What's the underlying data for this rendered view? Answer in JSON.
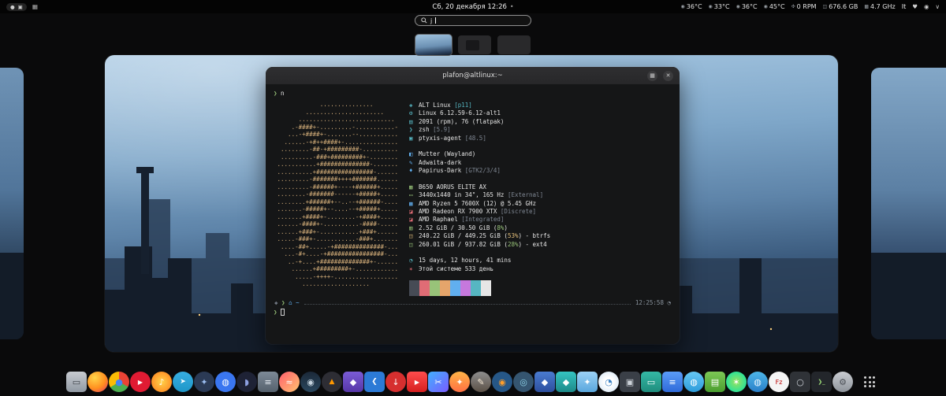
{
  "top_bar": {
    "clock": "Сб, 20 декабря 12:26",
    "notification_dot": "•",
    "keyboard_layout": "It",
    "indicators": {
      "record_glyph": "●",
      "screen_glyph": "▣",
      "tray_glyph": "▦"
    },
    "menu_icons": {
      "heart": "♥",
      "status": "◉",
      "chevron": "∨"
    },
    "stats": [
      {
        "name": "cpu-temp",
        "glyph": "◉",
        "value": "36°C"
      },
      {
        "name": "board-temp",
        "glyph": "◉",
        "value": "33°C"
      },
      {
        "name": "gpu-temp",
        "glyph": "◉",
        "value": "36°C"
      },
      {
        "name": "drive-temp",
        "glyph": "◉",
        "value": "45°C"
      },
      {
        "name": "fan-speed",
        "glyph": "✣",
        "value": "0 RPM"
      },
      {
        "name": "disk-free",
        "glyph": "◫",
        "value": "676.6 GB"
      },
      {
        "name": "cpu-freq",
        "glyph": "▩",
        "value": "4.7 GHz"
      }
    ]
  },
  "search": {
    "query": "j"
  },
  "workspaces": [
    {
      "name": "workspace-1",
      "active": true,
      "has_window": false
    },
    {
      "name": "workspace-2",
      "active": false,
      "has_window": true
    },
    {
      "name": "workspace-3",
      "active": false,
      "has_window": false
    }
  ],
  "terminal": {
    "title": "plafon@altlinux:~",
    "header_buttons": {
      "menu": "▦",
      "close": "✕"
    },
    "prompt_symbol": "❯",
    "command": "n",
    "ascii_color": "#d9b27c",
    "ascii_art": [
      "             ...............",
      "         ......................",
      "       ...........................",
      "     .-####+-.........-...........-",
      "    ...-+####+-.......--...........",
      "   ......-+#++####+-...............",
      "  ........-##-+#########-..........",
      "  .........-###+#########+-........",
      " ...........+##############-.......",
      " ..........+################-......",
      " .........-#######++++#######......",
      " .........-######+----+######+.....",
      " ........-#######------+#####+.....",
      " ........+######+--..--+######-....",
      " .......-#####+--....--+#####+.....",
      " .......+####+-........-+####+.....",
      " ......-####+-..........-####-.....",
      " ......+###+-...........+###+......",
      " .....-###+-...........-###+.......",
      "  ....-##+.....-+##############-...",
      "   ...-#+....-+################-...",
      "    ..-+....+##############+-......",
      "     ......+#########+-............",
      "      .....-++++-..................",
      "        ..................."
    ],
    "info": [
      {
        "icon": "◈",
        "ic": "#56b6c2",
        "parts": [
          {
            "t": "ALT Linux "
          },
          {
            "t": "[p11]",
            "c": "#56b6c2"
          }
        ]
      },
      {
        "icon": "⚙",
        "ic": "#56b6c2",
        "parts": [
          {
            "t": "Linux 6.12.59-6.12-alt1"
          }
        ]
      },
      {
        "icon": "▤",
        "ic": "#56b6c2",
        "parts": [
          {
            "t": "2091 (rpm), 76 (flatpak)"
          }
        ]
      },
      {
        "icon": "❯",
        "ic": "#56b6c2",
        "parts": [
          {
            "t": "zsh "
          },
          {
            "t": "[5.9]",
            "c": "#7f8793"
          }
        ]
      },
      {
        "icon": "▣",
        "ic": "#56b6c2",
        "parts": [
          {
            "t": "ptyxis-agent "
          },
          {
            "t": "[48.5]",
            "c": "#7f8793"
          }
        ]
      },
      {
        "blank": true
      },
      {
        "icon": "◧",
        "ic": "#61afef",
        "parts": [
          {
            "t": "Mutter (Wayland)"
          }
        ]
      },
      {
        "icon": "✎",
        "ic": "#61afef",
        "parts": [
          {
            "t": "Adwaita-dark"
          }
        ]
      },
      {
        "icon": "♦",
        "ic": "#61afef",
        "parts": [
          {
            "t": "Papirus-Dark "
          },
          {
            "t": "[GTK2/3/4]",
            "c": "#7f8793"
          }
        ]
      },
      {
        "blank": true
      },
      {
        "icon": "▦",
        "ic": "#98c379",
        "parts": [
          {
            "t": "B650 AORUS ELITE AX"
          }
        ]
      },
      {
        "icon": "▭",
        "ic": "#98c379",
        "parts": [
          {
            "t": "3440x1440 in 34\", 165 Hz "
          },
          {
            "t": "[External]",
            "c": "#7f8793"
          }
        ]
      },
      {
        "icon": "▩",
        "ic": "#61afef",
        "parts": [
          {
            "t": "AMD Ryzen 5 7600X (12) @ 5.45 GHz"
          }
        ]
      },
      {
        "icon": "◪",
        "ic": "#e06c75",
        "parts": [
          {
            "t": "AMD Radeon RX 7900 XTX "
          },
          {
            "t": "[Discrete]",
            "c": "#7f8793"
          }
        ]
      },
      {
        "icon": "◪",
        "ic": "#e06c75",
        "parts": [
          {
            "t": "AMD Raphael "
          },
          {
            "t": "[Integrated]",
            "c": "#7f8793"
          }
        ]
      },
      {
        "icon": "▥",
        "ic": "#98c379",
        "parts": [
          {
            "t": "2.52 GiB / 30.50 GiB ("
          },
          {
            "t": "8%",
            "c": "#98c379"
          },
          {
            "t": ")"
          }
        ]
      },
      {
        "icon": "◫",
        "ic": "#e5c07b",
        "parts": [
          {
            "t": "240.22 GiB / 449.25 GiB ("
          },
          {
            "t": "53%",
            "c": "#e5c07b"
          },
          {
            "t": ") - btrfs"
          }
        ]
      },
      {
        "icon": "◫",
        "ic": "#98c379",
        "parts": [
          {
            "t": "260.01 GiB / 937.82 GiB ("
          },
          {
            "t": "28%",
            "c": "#98c379"
          },
          {
            "t": ") - ext4"
          }
        ]
      },
      {
        "blank": true
      },
      {
        "icon": "◔",
        "ic": "#56b6c2",
        "parts": [
          {
            "t": "15 days, 12 hours, 41 mins"
          }
        ]
      },
      {
        "icon": "✶",
        "ic": "#e06c75",
        "parts": [
          {
            "t": "Этой системе 533 день"
          }
        ]
      }
    ],
    "palette": [
      "#464b55",
      "#e06c75",
      "#98c379",
      "#e5a56b",
      "#61afef",
      "#c678dd",
      "#56b6c2",
      "#e6e6e6"
    ],
    "status": {
      "lmark": "◆",
      "arrow": "❯",
      "path": "⌂ ~",
      "time": "12:25:58",
      "clock_glyph": "◔"
    },
    "cursor_prompt": "❯"
  },
  "dock": [
    {
      "n": "screenshot-tool",
      "bg": "linear-gradient(180deg,#c7cbd1,#9199a3)",
      "rd": "5px",
      "g": "▭",
      "gc": "#3c4147"
    },
    {
      "n": "firefox",
      "bg": "radial-gradient(circle at 35% 30%,#ffd54a,#ff8f1f 55%,#e3336d)",
      "rd": "50%",
      "g": "",
      "gc": "#fff"
    },
    {
      "n": "chromium",
      "bg": "conic-gradient(#ea4335 0 33%,#4caf50 33% 66%,#fbbc05 66% 100%)",
      "rd": "50%",
      "g": "●",
      "gc": "#4285f4"
    },
    {
      "n": "youtube-music",
      "bg": "#e01b33",
      "rd": "50%",
      "g": "▶",
      "gc": "#fff",
      "gs": "8px"
    },
    {
      "n": "music-app",
      "bg": "radial-gradient(circle,#ffd24a,#ff7a1a)",
      "rd": "50%",
      "g": "♪",
      "gc": "#fff"
    },
    {
      "n": "telegram",
      "bg": "linear-gradient(180deg,#37aee2,#1e96c8)",
      "rd": "50%",
      "g": "➤",
      "gc": "#fff",
      "gs": "9px"
    },
    {
      "n": "chat-app",
      "bg": "#2b3a55",
      "rd": "50%",
      "g": "✦",
      "gc": "#9bbdf0"
    },
    {
      "n": "messenger-app",
      "bg": "#3a76f0",
      "rd": "50%",
      "g": "◍",
      "gc": "#fff"
    },
    {
      "n": "discord",
      "bg": "#1e2235",
      "rd": "50%",
      "g": "◗",
      "gc": "#8ea1e1"
    },
    {
      "n": "text-editor",
      "bg": "linear-gradient(180deg,#7d8a97,#55616d)",
      "rd": "5px",
      "g": "≡",
      "gc": "#e8eef4"
    },
    {
      "n": "audio-editor",
      "bg": "linear-gradient(135deg,#ff5f6d,#ffc371)",
      "rd": "50%",
      "g": "≈",
      "gc": "#fff"
    },
    {
      "n": "steam",
      "bg": "linear-gradient(180deg,#1b2838,#2a475e)",
      "rd": "50%",
      "g": "◉",
      "gc": "#c7d5e0"
    },
    {
      "n": "game-launcher",
      "bg": "#2d2d34",
      "rd": "50%",
      "g": "▲",
      "gc": "#ff9800",
      "gs": "9px"
    },
    {
      "n": "heroic-launcher",
      "bg": "linear-gradient(180deg,#7b5cd6,#5636a7)",
      "rd": "5px",
      "g": "◆",
      "gc": "#fff"
    },
    {
      "n": "vscode",
      "bg": "#2c7ad6",
      "rd": "5px",
      "g": "❮",
      "gc": "#fff",
      "gs": "9px"
    },
    {
      "n": "download-manager",
      "bg": "#d62f2f",
      "rd": "50%",
      "g": "↓",
      "gc": "#fff"
    },
    {
      "n": "video-player",
      "bg": "linear-gradient(180deg,#ff4d4d,#d61f1f)",
      "rd": "5px",
      "g": "▶",
      "gc": "#fff",
      "gs": "8px"
    },
    {
      "n": "video-editor",
      "bg": "linear-gradient(135deg,#41b0ff,#7a5cff)",
      "rd": "5px",
      "g": "✂",
      "gc": "#fff"
    },
    {
      "n": "photo-tool",
      "bg": "linear-gradient(180deg,#ffb347,#ff7043)",
      "rd": "50%",
      "g": "✦",
      "gc": "#fff"
    },
    {
      "n": "gimp",
      "bg": "linear-gradient(180deg,#8d8d8d,#5c5147)",
      "rd": "50%",
      "g": "✎",
      "gc": "#f4e7d3"
    },
    {
      "n": "blender",
      "bg": "#265787",
      "rd": "50%",
      "g": "◉",
      "gc": "#ff9e2a"
    },
    {
      "n": "godot",
      "bg": "#355570",
      "rd": "50%",
      "g": "◎",
      "gc": "#8fd3e8"
    },
    {
      "n": "shield-app",
      "bg": "linear-gradient(180deg,#4a7bd0,#2d4f9e)",
      "rd": "5px",
      "g": "◆",
      "gc": "#fff"
    },
    {
      "n": "vpn-app",
      "bg": "linear-gradient(180deg,#35c3c1,#1d8a89)",
      "rd": "5px",
      "g": "◆",
      "gc": "#fff"
    },
    {
      "n": "utility-app",
      "bg": "linear-gradient(180deg,#9bd1f5,#5aa7dd)",
      "rd": "5px",
      "g": "✦",
      "gc": "#fff"
    },
    {
      "n": "disk-utility",
      "bg": "radial-gradient(circle,#ffffff 30%,#cfe3f5)",
      "rd": "50%",
      "g": "◔",
      "gc": "#3b82c4"
    },
    {
      "n": "package-manager",
      "bg": "#3a3f47",
      "rd": "5px",
      "g": "▣",
      "gc": "#cdd3da"
    },
    {
      "n": "display-tool",
      "bg": "linear-gradient(180deg,#34b8a5,#1f8d7d)",
      "rd": "5px",
      "g": "▭",
      "gc": "#fff"
    },
    {
      "n": "layers-app",
      "bg": "linear-gradient(180deg,#5a9cf8,#2f6ad9)",
      "rd": "5px",
      "g": "≡",
      "gc": "#fff"
    },
    {
      "n": "cloud-app",
      "bg": "linear-gradient(180deg,#66c7f4,#2d9cdb)",
      "rd": "50%",
      "g": "◍",
      "gc": "#fff"
    },
    {
      "n": "office-app",
      "bg": "linear-gradient(180deg,#7dc855,#4a9e2f)",
      "rd": "5px",
      "g": "▤",
      "gc": "#fff"
    },
    {
      "n": "green-app",
      "bg": "radial-gradient(circle,#9be15d,#00e3ae)",
      "rd": "50%",
      "g": "✶",
      "gc": "#fff"
    },
    {
      "n": "globe-app",
      "bg": "linear-gradient(180deg,#4db6e8,#2a7fc9)",
      "rd": "50%",
      "g": "◍",
      "gc": "#eaf6ff"
    },
    {
      "n": "filezilla",
      "bg": "#f5f5f5",
      "rd": "50%",
      "g": "Fz",
      "gc": "#bb0000",
      "gs": "8px"
    },
    {
      "n": "search-tool",
      "bg": "#2f3237",
      "rd": "5px",
      "g": "○",
      "gc": "#cfd4da"
    },
    {
      "n": "terminal-app",
      "bg": "#23262b",
      "rd": "5px",
      "g": "❯_",
      "gc": "#9fe07a",
      "gs": "7px"
    },
    {
      "n": "settings",
      "bg": "linear-gradient(180deg,#c9ccd1,#8f959c)",
      "rd": "50%",
      "g": "⚙",
      "gc": "#4a4f55"
    }
  ]
}
